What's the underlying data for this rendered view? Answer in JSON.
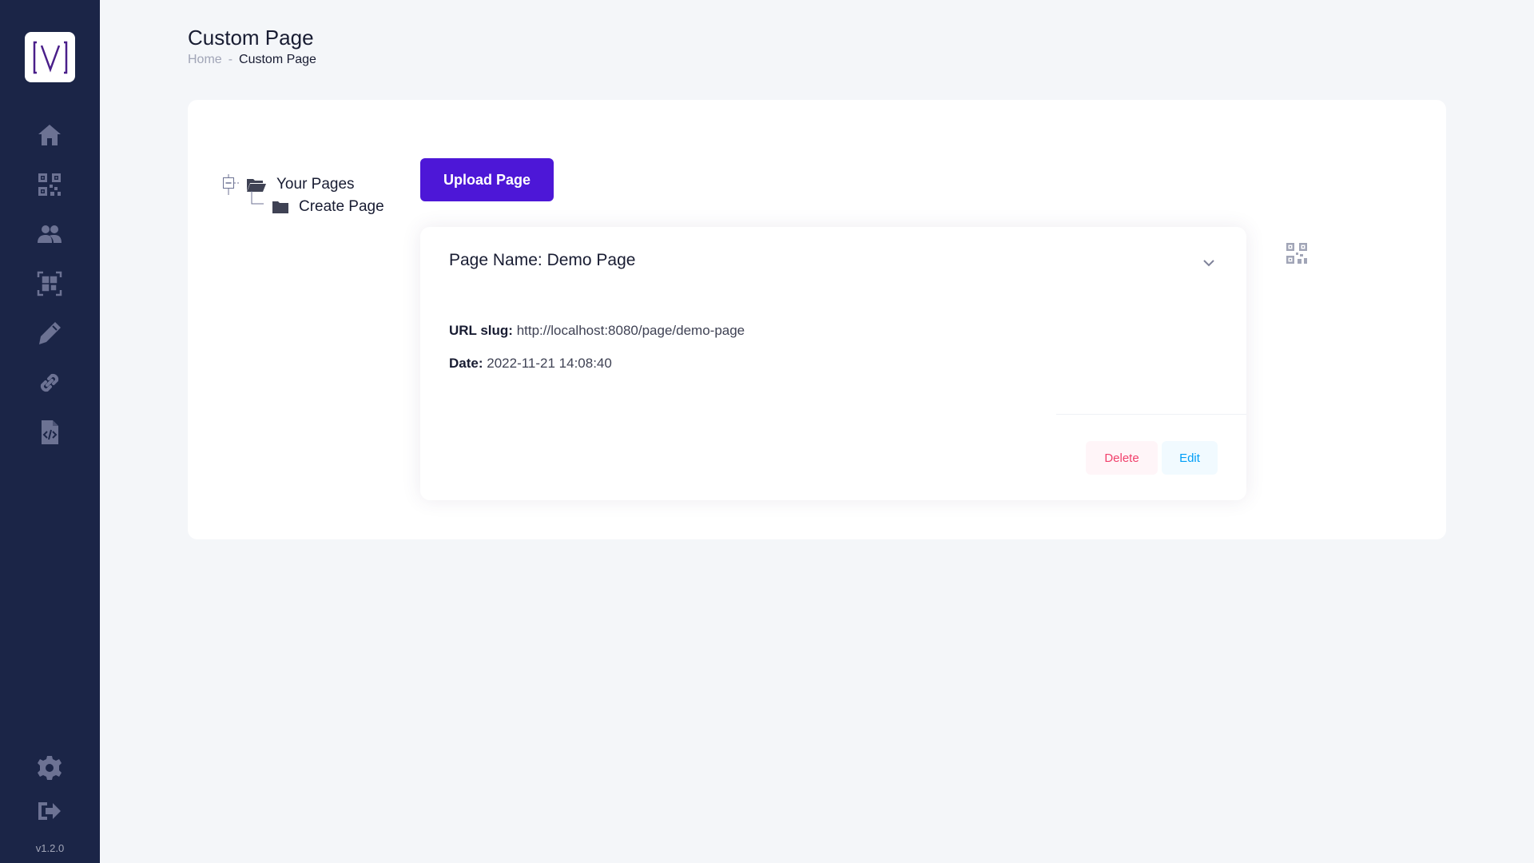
{
  "app": {
    "version": "v1.2.0",
    "colors": {
      "sidebar": "#1b2547",
      "accent": "#4d17d7",
      "danger": "#f1416c",
      "info": "#009ef7"
    }
  },
  "sidebar": {
    "items": [
      {
        "icon": "home-icon"
      },
      {
        "icon": "qr-code-icon"
      },
      {
        "icon": "users-icon"
      },
      {
        "icon": "qr-scan-icon"
      },
      {
        "icon": "pen-icon"
      },
      {
        "icon": "link-icon"
      },
      {
        "icon": "file-code-icon"
      }
    ],
    "bottom_items": [
      {
        "icon": "gear-icon"
      },
      {
        "icon": "logout-icon"
      }
    ]
  },
  "header": {
    "title": "Custom Page",
    "breadcrumb": {
      "home": "Home",
      "separator": "-",
      "current": "Custom Page"
    }
  },
  "tree": {
    "root": "Your Pages",
    "child": "Create Page"
  },
  "toolbar": {
    "upload_label": "Upload Page"
  },
  "page_card": {
    "title": "Page Name: Demo Page",
    "url_label": "URL slug:",
    "url_value": "http://localhost:8080/page/demo-page",
    "date_label": "Date:",
    "date_value": "2022-11-21 14:08:40",
    "delete_label": "Delete",
    "edit_label": "Edit"
  }
}
